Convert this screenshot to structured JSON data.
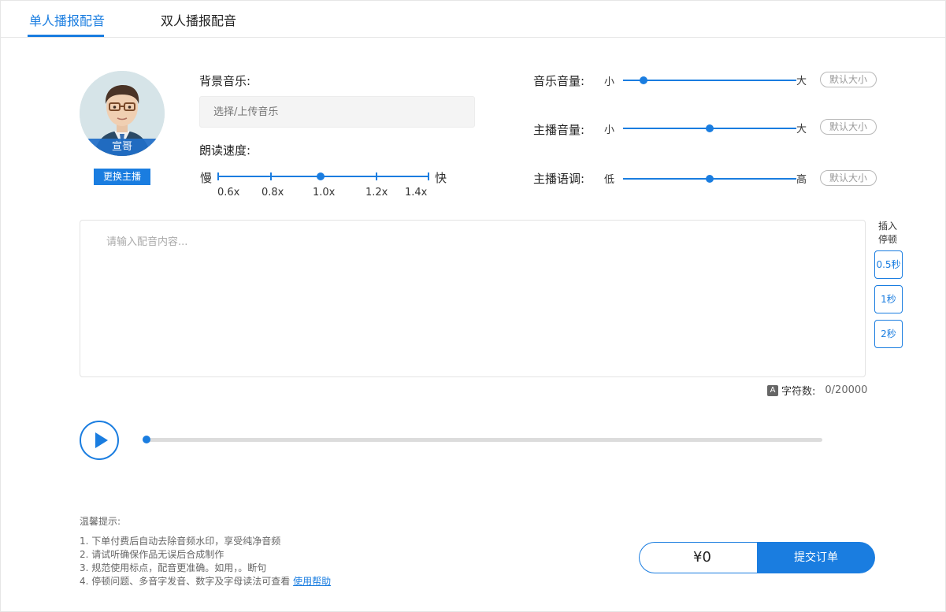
{
  "tabs": [
    {
      "label": "单人播报配音",
      "active": true
    },
    {
      "label": "双人播报配音",
      "active": false
    }
  ],
  "anchor": {
    "name": "宣哥",
    "change_label": "更换主播"
  },
  "music": {
    "label": "背景音乐:",
    "placeholder": "选择/上传音乐"
  },
  "speed": {
    "label": "朗读速度:",
    "min_label": "慢",
    "max_label": "快",
    "ticks": [
      "0.6x",
      "0.8x",
      "1.0x",
      "1.2x",
      "1.4x"
    ],
    "current": "1.0x"
  },
  "sliders": [
    {
      "label": "音乐音量:",
      "min_label": "小",
      "max_label": "大",
      "value": 0.12,
      "reset_label": "默认大小"
    },
    {
      "label": "主播音量:",
      "min_label": "小",
      "max_label": "大",
      "value": 0.5,
      "reset_label": "默认大小"
    },
    {
      "label": "主播语调:",
      "min_label": "低",
      "max_label": "高",
      "value": 0.5,
      "reset_label": "默认大小"
    }
  ],
  "content": {
    "placeholder": "请输入配音内容...",
    "value": ""
  },
  "pause": {
    "label": "插入停顿",
    "options": [
      "0.5秒",
      "1秒",
      "2秒"
    ]
  },
  "char_count": {
    "icon": "A",
    "label": "字符数:",
    "value": "0/20000"
  },
  "player": {
    "progress": 0
  },
  "tips": {
    "title": "温馨提示:",
    "items": [
      "1. 下单付费后自动去除音频水印，享受纯净音频",
      "2. 请试听确保作品无误后合成制作",
      "3. 规范使用标点，配音更准确。如用，。断句",
      "4. 停顿问题、多音字发音、数字及字母读法可查看"
    ],
    "help_link": "使用帮助"
  },
  "order": {
    "price": "¥0",
    "submit_label": "提交订单"
  },
  "colors": {
    "accent": "#1a7de0"
  }
}
